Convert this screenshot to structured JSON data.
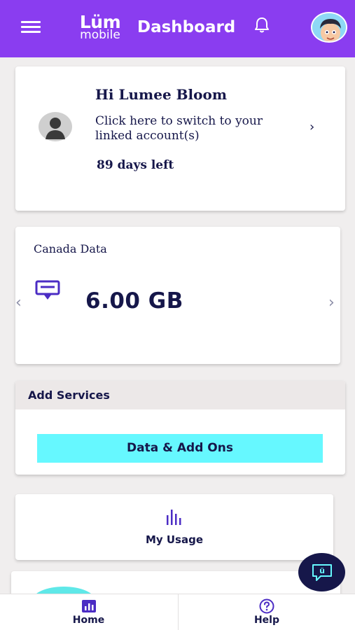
{
  "header": {
    "logo_main": "Lüm",
    "logo_sub": "mobile",
    "title": "Dashboard",
    "menu_icon": "hamburger-menu-icon",
    "notification_icon": "bell-icon",
    "avatar_icon": "cartoon-avatar-icon",
    "brand_color": "#8a3df0"
  },
  "account": {
    "greeting": "Hi Lumee Bloom",
    "switch_text": "Click here to switch to your linked account(s)",
    "arrow": "›",
    "days_left": "89 days left",
    "avatar_icon": "default-user-avatar-icon"
  },
  "data_balance": {
    "label": "Canada Data",
    "value": "6.00 GB",
    "icon": "sim-card-icon",
    "prev": "‹",
    "next": "›"
  },
  "services": {
    "title": "Add Services",
    "button_label": "Data & Add Ons",
    "button_color": "#66f8ff"
  },
  "usage": {
    "label": "My Usage",
    "icon": "usage-bars-icon"
  },
  "chat": {
    "icon": "chat-bubble-icon",
    "glyph": "ü"
  },
  "bottom_nav": {
    "items": [
      {
        "label": "Home",
        "icon": "home-chart-icon",
        "active": true
      },
      {
        "label": "Help",
        "icon": "question-circle-icon",
        "active": false
      }
    ]
  }
}
